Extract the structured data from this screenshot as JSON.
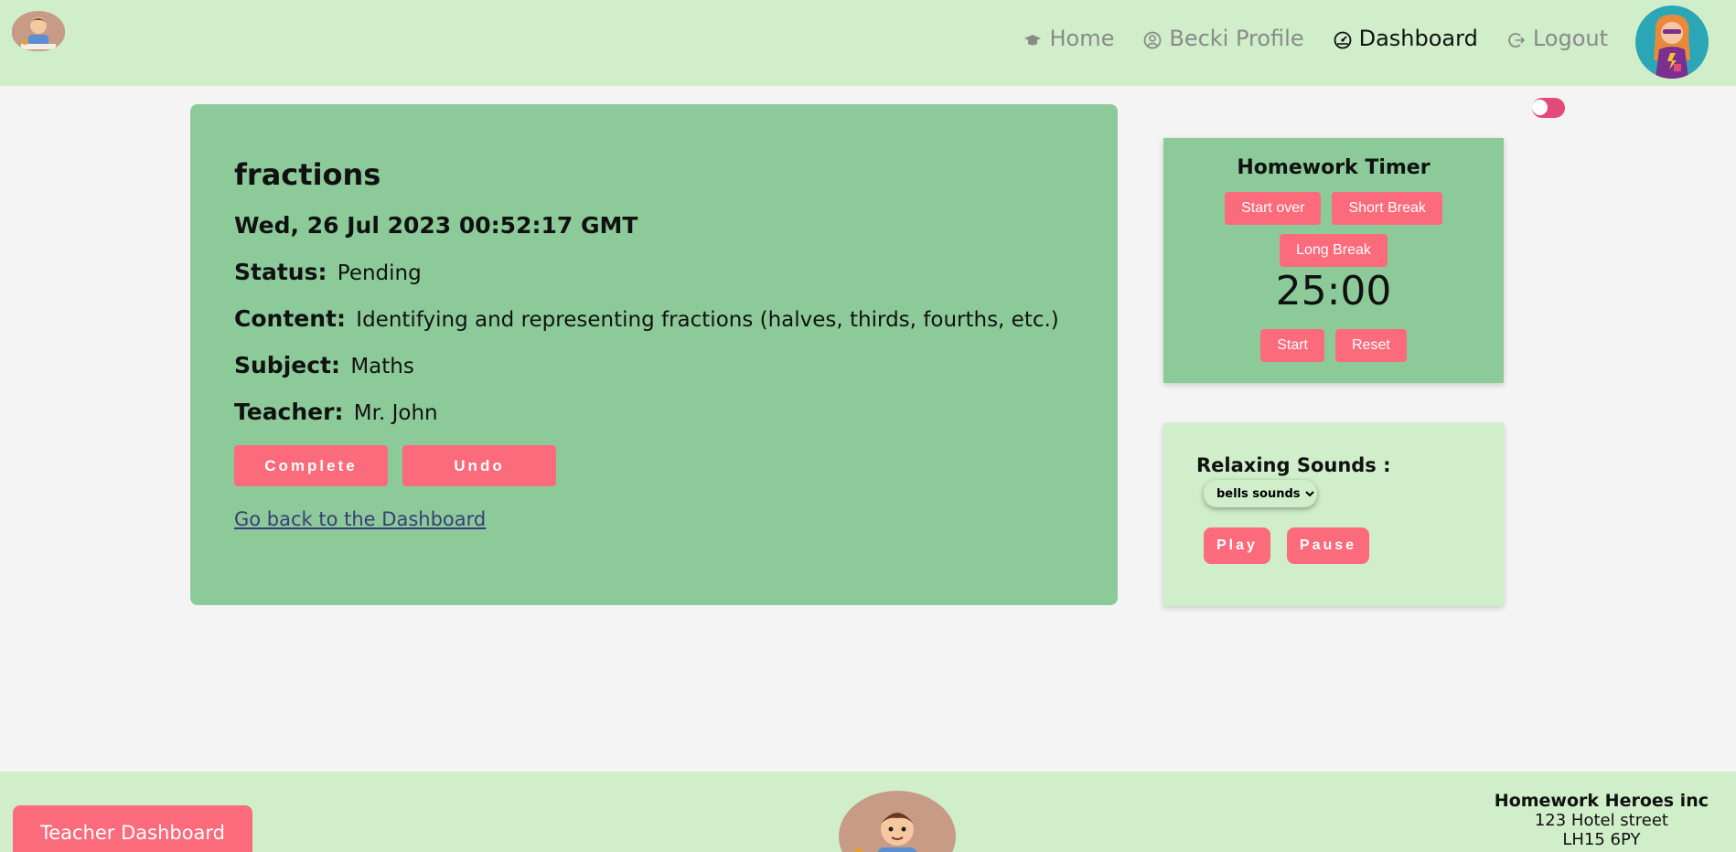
{
  "nav": {
    "home": "Home",
    "profile": "Becki Profile",
    "dashboard": "Dashboard",
    "logout": "Logout"
  },
  "task": {
    "title": "fractions",
    "date": "Wed, 26 Jul 2023 00:52:17 GMT",
    "status_label": "Status:",
    "status": "Pending",
    "content_label": "Content:",
    "content": "Identifying and representing fractions (halves, thirds, fourths, etc.)",
    "subject_label": "Subject:",
    "subject": "Maths",
    "teacher_label": "Teacher:",
    "teacher": "Mr. John",
    "complete_btn": "Complete",
    "undo_btn": "Undo",
    "back_link": "Go back to the Dashboard"
  },
  "timer": {
    "title": "Homework Timer",
    "start_over": "Start over",
    "short_break": "Short Break",
    "long_break": "Long Break",
    "display": "25:00",
    "start": "Start",
    "reset": "Reset"
  },
  "sounds": {
    "title": "Relaxing Sounds :",
    "selected": "bells sounds",
    "play": "Play",
    "pause": "Pause"
  },
  "footer": {
    "teacher_dashboard": "Teacher Dashboard",
    "company_name": "Homework Heroes inc",
    "address_line1": "123 Hotel street",
    "address_line2": "LH15 6PY"
  },
  "colors": {
    "accent": "#fb6b7b",
    "card": "#8ccb99",
    "header": "#cfeec9",
    "toggle": "#e24a7a"
  },
  "icons": {
    "home": "graduation-cap-icon",
    "profile": "user-circle-icon",
    "dashboard": "dashboard-gauge-icon",
    "logout": "logout-icon"
  }
}
